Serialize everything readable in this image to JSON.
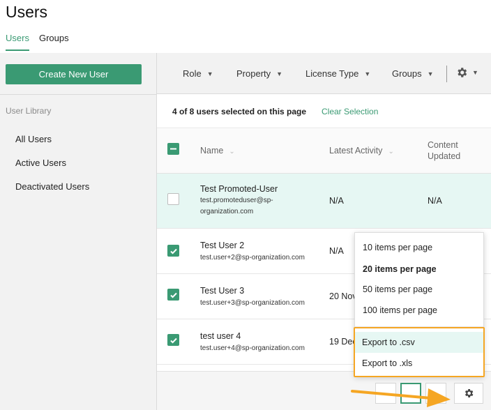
{
  "page": {
    "title": "Users"
  },
  "tabs": [
    {
      "label": "Users",
      "active": true
    },
    {
      "label": "Groups",
      "active": false
    }
  ],
  "sidebar": {
    "create_button": "Create New User",
    "library_heading": "User Library",
    "items": [
      "All Users",
      "Active Users",
      "Deactivated Users"
    ]
  },
  "filters": {
    "items": [
      "Role",
      "Property",
      "License Type",
      "Groups"
    ],
    "settings_icon": "gear-icon"
  },
  "selection": {
    "status": "4 of 8 users selected on this page",
    "clear_label": "Clear Selection"
  },
  "table": {
    "headers": {
      "name": "Name",
      "activity": "Latest Activity",
      "updated_line1": "Content",
      "updated_line2": "Updated"
    },
    "rows": [
      {
        "name": "Test Promoted-User",
        "email": "test.promoteduser@sp-organization.com",
        "activity": "N/A",
        "updated": "N/A",
        "checked": false
      },
      {
        "name": "Test User 2",
        "email": "test.user+2@sp-organization.com",
        "activity": "N/A",
        "updated": "",
        "checked": true
      },
      {
        "name": "Test User 3",
        "email": "test.user+3@sp-organization.com",
        "activity": "20 Nov",
        "updated": "",
        "checked": true
      },
      {
        "name": "test user 4",
        "email": "test.user+4@sp-organization.com",
        "activity": "19 Dec",
        "updated": "",
        "checked": true
      }
    ]
  },
  "menu": {
    "page_sizes": [
      "10 items per page",
      "20 items per page",
      "50 items per page",
      "100 items per page"
    ],
    "selected_page_size": "20 items per page",
    "exports": [
      "Export to .csv",
      "Export to .xls"
    ]
  },
  "colors": {
    "accent": "#3a9a73",
    "highlight": "#f5a623",
    "selected_row": "#e6f7f3"
  }
}
